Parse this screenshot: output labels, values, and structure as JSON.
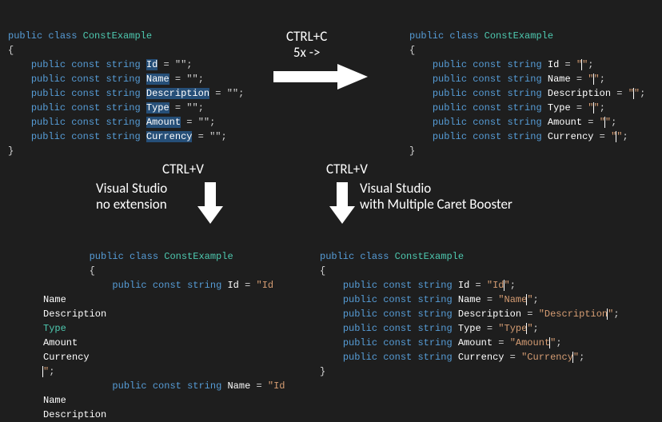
{
  "top_left": {
    "class_decl": {
      "public": "public",
      "class": "class",
      "name": "ConstExample"
    },
    "open": "{",
    "lines": [
      {
        "pre": "public const string ",
        "id": "Id",
        "post": " = \"\";"
      },
      {
        "pre": "public const string ",
        "id": "Name",
        "post": " = \"\";"
      },
      {
        "pre": "public const string ",
        "id": "Description",
        "post": " = \"\";"
      },
      {
        "pre": "public const string ",
        "id": "Type",
        "post": " = \"\";"
      },
      {
        "pre": "public const string ",
        "id": "Amount",
        "post": " = \"\";"
      },
      {
        "pre": "public const string ",
        "id": "Currency",
        "post": " = \"\";"
      }
    ],
    "close": "}"
  },
  "top_right": {
    "class_decl": {
      "public": "public",
      "class": "class",
      "name": "ConstExample"
    },
    "open": "{",
    "lines": [
      {
        "pre": "public const string ",
        "id": "Id",
        "val": "",
        "post": ";"
      },
      {
        "pre": "public const string ",
        "id": "Name",
        "val": "",
        "post": ";"
      },
      {
        "pre": "public const string ",
        "id": "Description",
        "val": "",
        "post": ";"
      },
      {
        "pre": "public const string ",
        "id": "Type",
        "val": "",
        "post": ";"
      },
      {
        "pre": "public const string ",
        "id": "Amount",
        "val": "",
        "post": ";"
      },
      {
        "pre": "public const string ",
        "id": "Currency",
        "val": "",
        "post": ";"
      }
    ],
    "close": "}"
  },
  "bottom_left": {
    "class_decl": {
      "public": "public",
      "class": "class",
      "name": "ConstExample"
    },
    "open": "{",
    "line_a": {
      "pre": "public const string ",
      "id": "Id",
      "eq": " = ",
      "q": "\"",
      "val": "Id"
    },
    "dump": [
      "Name",
      "Description",
      "Type",
      "Amount",
      "Currency",
      "\";"
    ],
    "line_b": {
      "pre": "public const string ",
      "id": "Name",
      "eq": " = ",
      "q": "\"",
      "val": "Id"
    },
    "dump2": [
      "Name",
      "Description"
    ]
  },
  "bottom_right": {
    "class_decl": {
      "public": "public",
      "class": "class",
      "name": "ConstExample"
    },
    "open": "{",
    "lines": [
      {
        "pre": "public const string ",
        "id": "Id",
        "val": "Id",
        "post": ";"
      },
      {
        "pre": "public const string ",
        "id": "Name",
        "val": "Name",
        "post": ";"
      },
      {
        "pre": "public const string ",
        "id": "Description",
        "val": "Description",
        "post": ";"
      },
      {
        "pre": "public const string ",
        "id": "Type",
        "val": "Type",
        "post": ";"
      },
      {
        "pre": "public const string ",
        "id": "Amount",
        "val": "Amount",
        "post": ";"
      },
      {
        "pre": "public const string ",
        "id": "Currency",
        "val": "Currency",
        "post": ";"
      }
    ],
    "close": "}"
  },
  "annotations": {
    "copy": "CTRL+C",
    "copy_sub": "5x ->",
    "paste_left_title": "CTRL+V",
    "paste_left_sub1": "Visual Studio",
    "paste_left_sub2": "no extension",
    "paste_right_title": "CTRL+V",
    "paste_right_sub1": "Visual Studio",
    "paste_right_sub2": "with Multiple Caret Booster"
  }
}
